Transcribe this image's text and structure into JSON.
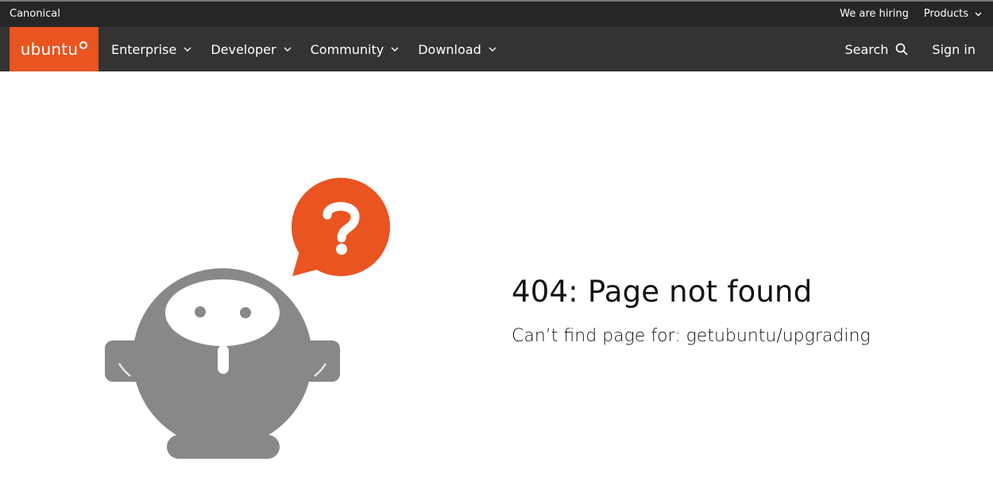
{
  "meta_bar": {
    "brand": "Canonical",
    "hiring": "We are hiring",
    "products": "Products"
  },
  "nav": {
    "logo": "ubuntu",
    "items": [
      {
        "label": "Enterprise"
      },
      {
        "label": "Developer"
      },
      {
        "label": "Community"
      },
      {
        "label": "Download"
      }
    ],
    "search": "Search",
    "sign_in": "Sign in"
  },
  "error": {
    "title": "404: Page not found",
    "message": "Can’t find page for: getubuntu/upgrading"
  },
  "colors": {
    "accent": "#e95420",
    "nav_bg": "#333333",
    "meta_bg": "#262626",
    "mascot": "#888888"
  },
  "icons": {
    "chevron": "chevron-down-icon",
    "search": "search-icon",
    "question": "question-mark-icon"
  }
}
